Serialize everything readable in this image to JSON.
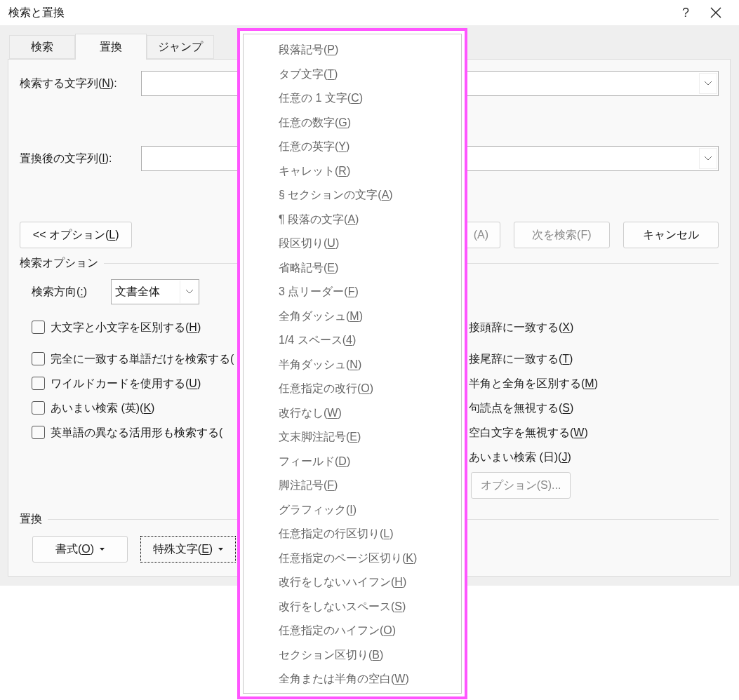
{
  "window": {
    "title": "検索と置換",
    "help": "?"
  },
  "tabs": [
    {
      "label": "検索",
      "selected": false
    },
    {
      "label": "置換",
      "selected": true
    },
    {
      "label": "ジャンプ",
      "selected": false
    }
  ],
  "find_field": {
    "label": "検索する文字列(",
    "key": "N",
    "tail": "):"
  },
  "replace_field": {
    "label": "置換後の文字列(",
    "key": "I",
    "tail": "):"
  },
  "buttons": [
    {
      "label": "<< オプション(",
      "key": "L",
      "tail": ")",
      "disabled": false
    },
    {
      "label": "(A)",
      "disabled": true
    },
    {
      "label": "次を検索(F)",
      "disabled": true
    },
    {
      "label": "キャンセル",
      "disabled": false
    }
  ],
  "search_options": {
    "title": "検索オプション",
    "direction": {
      "label": "検索方向(",
      "key": ":",
      "tail": ")",
      "value": "文書全体"
    },
    "checkboxes": [
      {
        "label": "大文字と小文字を区別する(",
        "key": "H",
        "tail": ")",
        "checked": false
      },
      {
        "label": "完全に一致する単語だけを検索する(",
        "checked": false
      },
      {
        "label": "ワイルドカードを使用する(",
        "key": "U",
        "tail": ")",
        "checked": false
      },
      {
        "label": "あいまい検索 (英)(",
        "key": "K",
        "tail": ")",
        "checked": false
      },
      {
        "label": "英単語の異なる活用形も検索する(",
        "checked": false
      }
    ],
    "right_options": [
      {
        "label": "接頭辞に一致する(",
        "key": "X",
        "tail": ")"
      },
      {
        "label": "接尾辞に一致する(",
        "key": "T",
        "tail": ")"
      },
      {
        "label": "半角と全角を区別する(",
        "key": "M",
        "tail": ")"
      },
      {
        "label": "句読点を無視する(",
        "key": "S",
        "tail": ")"
      },
      {
        "label": "空白文字を無視する(",
        "key": "W",
        "tail": ")"
      },
      {
        "label": "あいまい検索 (日)(",
        "key": "J",
        "tail": ")"
      }
    ],
    "options_button": {
      "label": "オプション(S)...",
      "disabled": true
    }
  },
  "replace_section": {
    "title": "置換",
    "buttons": [
      {
        "label": "書式(",
        "key": "O",
        "tail": ")",
        "focused": false
      },
      {
        "label": "特殊文字(",
        "key": "E",
        "tail": ")",
        "focused": true
      }
    ]
  },
  "special_menu": [
    {
      "label": "段落記号(",
      "key": "P",
      "tail": ")"
    },
    {
      "label": "タブ文字(",
      "key": "T",
      "tail": ")"
    },
    {
      "label": "任意の 1 文字(",
      "key": "C",
      "tail": ")"
    },
    {
      "label": "任意の数字(",
      "key": "G",
      "tail": ")"
    },
    {
      "label": "任意の英字(",
      "key": "Y",
      "tail": ")"
    },
    {
      "label": "キャレット(",
      "key": "R",
      "tail": ")"
    },
    {
      "label": "§ セクションの文字(",
      "key": "A",
      "tail": ")"
    },
    {
      "label": "¶ 段落の文字(",
      "key": "A",
      "tail": ")"
    },
    {
      "label": "段区切り(",
      "key": "U",
      "tail": ")"
    },
    {
      "label": "省略記号(",
      "key": "E",
      "tail": ")"
    },
    {
      "label": "3 点リーダー(",
      "key": "F",
      "tail": ")"
    },
    {
      "label": "全角ダッシュ(",
      "key": "M",
      "tail": ")"
    },
    {
      "label": "1/4 スペース(",
      "key": "4",
      "tail": ")"
    },
    {
      "label": "半角ダッシュ(",
      "key": "N",
      "tail": ")"
    },
    {
      "label": "任意指定の改行(",
      "key": "O",
      "tail": ")"
    },
    {
      "label": "改行なし(",
      "key": "W",
      "tail": ")"
    },
    {
      "label": "文末脚注記号(",
      "key": "E",
      "tail": ")"
    },
    {
      "label": "フィールド(",
      "key": "D",
      "tail": ")"
    },
    {
      "label": "脚注記号(",
      "key": "F",
      "tail": ")"
    },
    {
      "label": "グラフィック(",
      "key": "I",
      "tail": ")"
    },
    {
      "label": "任意指定の行区切り(",
      "key": "L",
      "tail": ")"
    },
    {
      "label": "任意指定のページ区切り(",
      "key": "K",
      "tail": ")"
    },
    {
      "label": "改行をしないハイフン(",
      "key": "H",
      "tail": ")"
    },
    {
      "label": "改行をしないスペース(",
      "key": "S",
      "tail": ")"
    },
    {
      "label": "任意指定のハイフン(",
      "key": "O",
      "tail": ")"
    },
    {
      "label": "セクション区切り(",
      "key": "B",
      "tail": ")"
    },
    {
      "label": "全角または半角の空白(",
      "key": "W",
      "tail": ")"
    }
  ]
}
